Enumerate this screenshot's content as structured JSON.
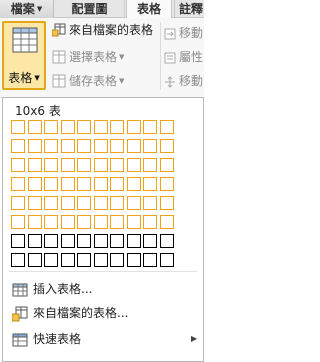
{
  "tabs": [
    {
      "label": "檔案",
      "state": "dropdown"
    },
    {
      "label": "配置圖",
      "state": "normal"
    },
    {
      "label": "表格",
      "state": "active"
    },
    {
      "label": "註釋",
      "state": "partial"
    }
  ],
  "ribbon": {
    "table_button_label": "表格",
    "from_file_table": "來自檔案的表格",
    "select_table": "選擇表格",
    "save_table": "儲存表格",
    "move_right": "移動",
    "properties": "屬性",
    "move_right2": "移動"
  },
  "grid": {
    "caption": "10x6 表",
    "columns": 10,
    "rows": 8,
    "selected_columns": 10,
    "selected_rows": 6,
    "highlight_color": "#f0a21b"
  },
  "menu": {
    "insert_table": "插入表格...",
    "table_from_file": "來自檔案的表格...",
    "quick_table": "快速表格"
  },
  "colors": {
    "active_button_bg": "#fce7a6",
    "active_button_border": "#e3a61b"
  }
}
